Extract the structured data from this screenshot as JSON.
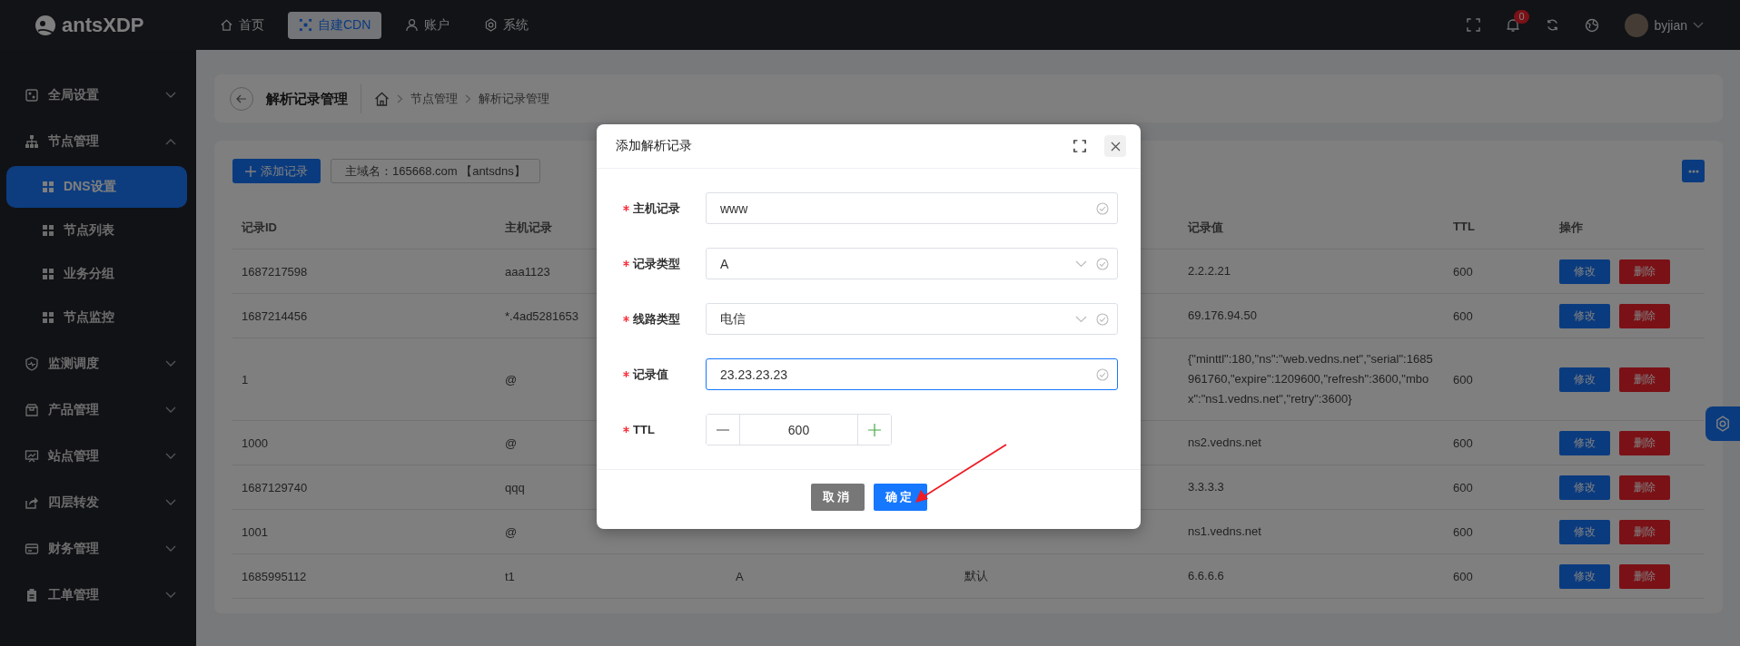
{
  "topbar": {
    "logo": "antsXDP",
    "nav": [
      {
        "label": "首页",
        "selected": false
      },
      {
        "label": "自建CDN",
        "selected": true
      },
      {
        "label": "账户",
        "selected": false
      },
      {
        "label": "系统",
        "selected": false
      }
    ],
    "notifications": "0",
    "user": "byjian"
  },
  "sidebar": {
    "items": [
      {
        "label": "全局设置",
        "expanded": false
      },
      {
        "label": "节点管理",
        "expanded": true,
        "children": [
          {
            "label": "DNS设置",
            "selected": true
          },
          {
            "label": "节点列表",
            "selected": false
          },
          {
            "label": "业务分组",
            "selected": false
          },
          {
            "label": "节点监控",
            "selected": false
          }
        ]
      },
      {
        "label": "监测调度",
        "expanded": false
      },
      {
        "label": "产品管理",
        "expanded": false
      },
      {
        "label": "站点管理",
        "expanded": false
      },
      {
        "label": "四层转发",
        "expanded": false
      },
      {
        "label": "财务管理",
        "expanded": false
      },
      {
        "label": "工单管理",
        "expanded": false
      }
    ]
  },
  "page": {
    "title": "解析记录管理",
    "breadcrumb": [
      "节点管理",
      "解析记录管理"
    ]
  },
  "toolbar": {
    "add_button": "添加记录",
    "domain": "主域名：165668.com 【antsdns】"
  },
  "table": {
    "columns": [
      "记录ID",
      "主机记录",
      "记录值",
      "TTL",
      "操作"
    ],
    "rows": [
      {
        "id": "1687217598",
        "host": "aaa1123",
        "value": "2.2.2.21",
        "ttl": "600",
        "actions": [
          "修改",
          "删除"
        ]
      },
      {
        "id": "1687214456",
        "host": "*.4ad5281653",
        "value": "69.176.94.50",
        "ttl": "600",
        "actions": [
          "修改",
          "删除"
        ]
      },
      {
        "id": "1",
        "host": "@",
        "value": "{\"minttl\":180,\"ns\":\"web.vedns.net\",\"serial\":1685961760,\"expire\":1209600,\"refresh\":3600,\"mbox\":\"ns1.vedns.net\",\"retry\":3600}",
        "ttl": "600",
        "actions": [
          "修改",
          "删除"
        ]
      },
      {
        "id": "1000",
        "host": "@",
        "value": "ns2.vedns.net",
        "ttl": "600",
        "actions": [
          "修改",
          "删除"
        ]
      },
      {
        "id": "1687129740",
        "host": "qqq",
        "value": "3.3.3.3",
        "ttl": "600",
        "actions": [
          "修改",
          "删除"
        ]
      },
      {
        "id": "1001",
        "host": "@",
        "value": "ns1.vedns.net",
        "ttl": "600",
        "actions": [
          "修改",
          "删除"
        ]
      },
      {
        "id": "1685995112",
        "host": "t1",
        "column_3": "A",
        "column_4": "默认",
        "value": "6.6.6.6",
        "ttl": "600",
        "actions": [
          "修改",
          "删除"
        ]
      }
    ]
  },
  "modal": {
    "title": "添加解析记录",
    "fields": [
      {
        "label": "主机记录",
        "required": true,
        "kind": "text",
        "value": "www",
        "focused": false
      },
      {
        "label": "记录类型",
        "required": true,
        "kind": "select",
        "value": "A",
        "focused": false
      },
      {
        "label": "线路类型",
        "required": true,
        "kind": "select",
        "value": "电信",
        "focused": false
      },
      {
        "label": "记录值",
        "required": true,
        "kind": "text",
        "value": "23.23.23.23",
        "focused": true
      },
      {
        "label": "TTL",
        "required": true,
        "kind": "number",
        "value": "600",
        "focused": false
      }
    ],
    "buttons": [
      {
        "label": "取消",
        "kind": "cancel"
      },
      {
        "label": "确定",
        "kind": "primary"
      }
    ]
  }
}
